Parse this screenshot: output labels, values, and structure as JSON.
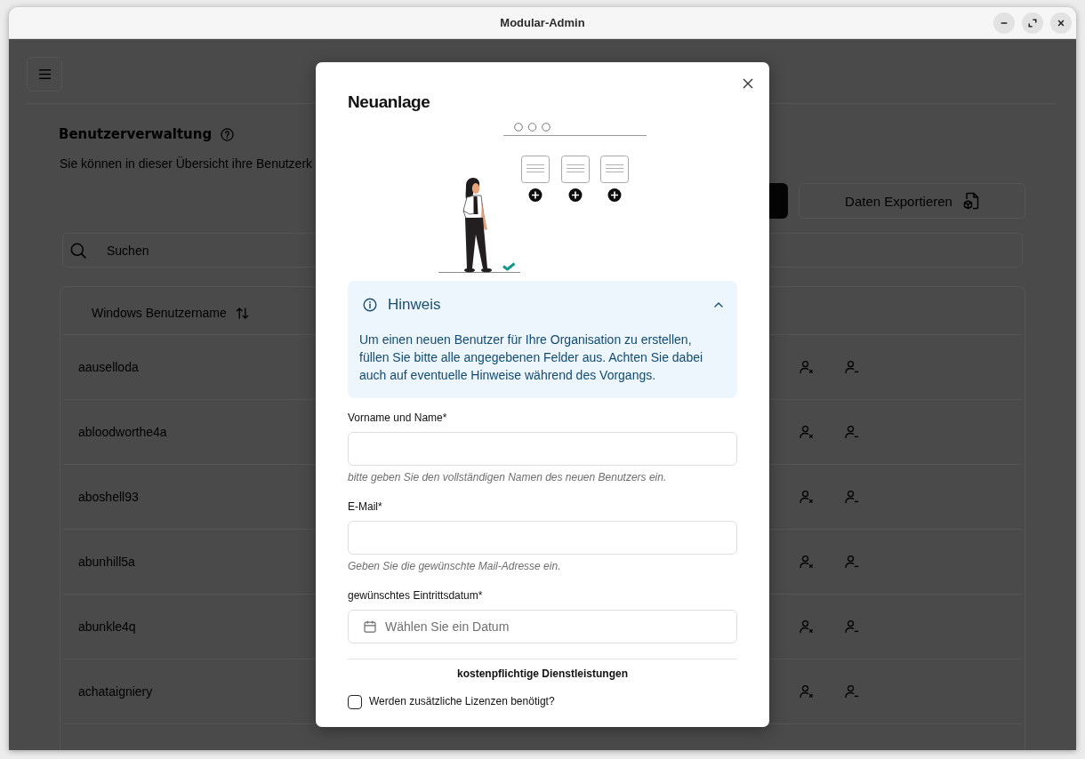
{
  "window": {
    "title": "Modular-Admin"
  },
  "page": {
    "title": "Benutzerverwaltung",
    "subtitle": "Sie können in dieser Übersicht ihre Benutzerk",
    "export_button": "Daten Exportieren",
    "search": {
      "placeholder": "Suchen"
    }
  },
  "table": {
    "columns": [
      {
        "label": "Windows Benutzername"
      }
    ],
    "rows": [
      {
        "username": "aauselloda"
      },
      {
        "username": "abloodworthe4a"
      },
      {
        "username": "aboshell93"
      },
      {
        "username": "abunhill5a"
      },
      {
        "username": "abunkle4q"
      },
      {
        "username": "achataigniery"
      }
    ]
  },
  "dialog": {
    "title": "Neuanlage",
    "notice": {
      "title": "Hinweis",
      "expanded": true,
      "text": "Um einen neuen Benutzer für Ihre Organisation zu erstellen, füllen Sie bitte alle angegebenen Felder aus. Achten Sie dabei auch auf eventuelle Hinweise während des Vorgangs."
    },
    "fields": [
      {
        "kind": "text",
        "label": "Vorname und Name*",
        "help": "bitte geben Sie den vollständigen Namen des neuen Benutzers ein."
      },
      {
        "kind": "text",
        "label": "E-Mail*",
        "help": "Geben Sie die gewünschte Mail-Adresse ein."
      },
      {
        "kind": "date",
        "label": "gewünschtes Eintrittsdatum*",
        "placeholder": "Wählen Sie ein Datum"
      }
    ],
    "section_title": "kostenpflichtige Dienstleistungen",
    "checkboxes": [
      {
        "label": "Werden zusätzliche Lizenzen benötigt?",
        "checked": false
      }
    ]
  }
}
